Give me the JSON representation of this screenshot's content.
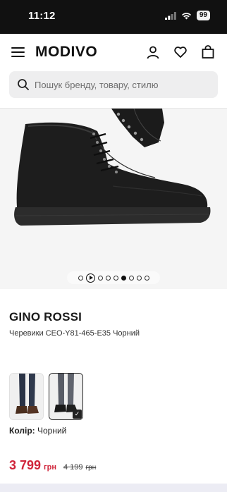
{
  "status_bar": {
    "time": "11:12",
    "battery": "99"
  },
  "header": {
    "logo": "MODIVO"
  },
  "search": {
    "placeholder": "Пошук бренду, товару, стилю"
  },
  "gallery": {
    "total_images": 9,
    "active_index": 5,
    "has_video": true
  },
  "product": {
    "brand": "GINO ROSSI",
    "name": "Черевики CEO-Y81-465-E35 Чорний",
    "color_label": "Колір:",
    "color_value": "Чорний"
  },
  "price": {
    "current": "3 799",
    "currency": "грн",
    "old": "4 199",
    "old_currency": "грн",
    "accent_color": "#d0243a"
  },
  "variants": {
    "count": 2,
    "selected": 1
  }
}
